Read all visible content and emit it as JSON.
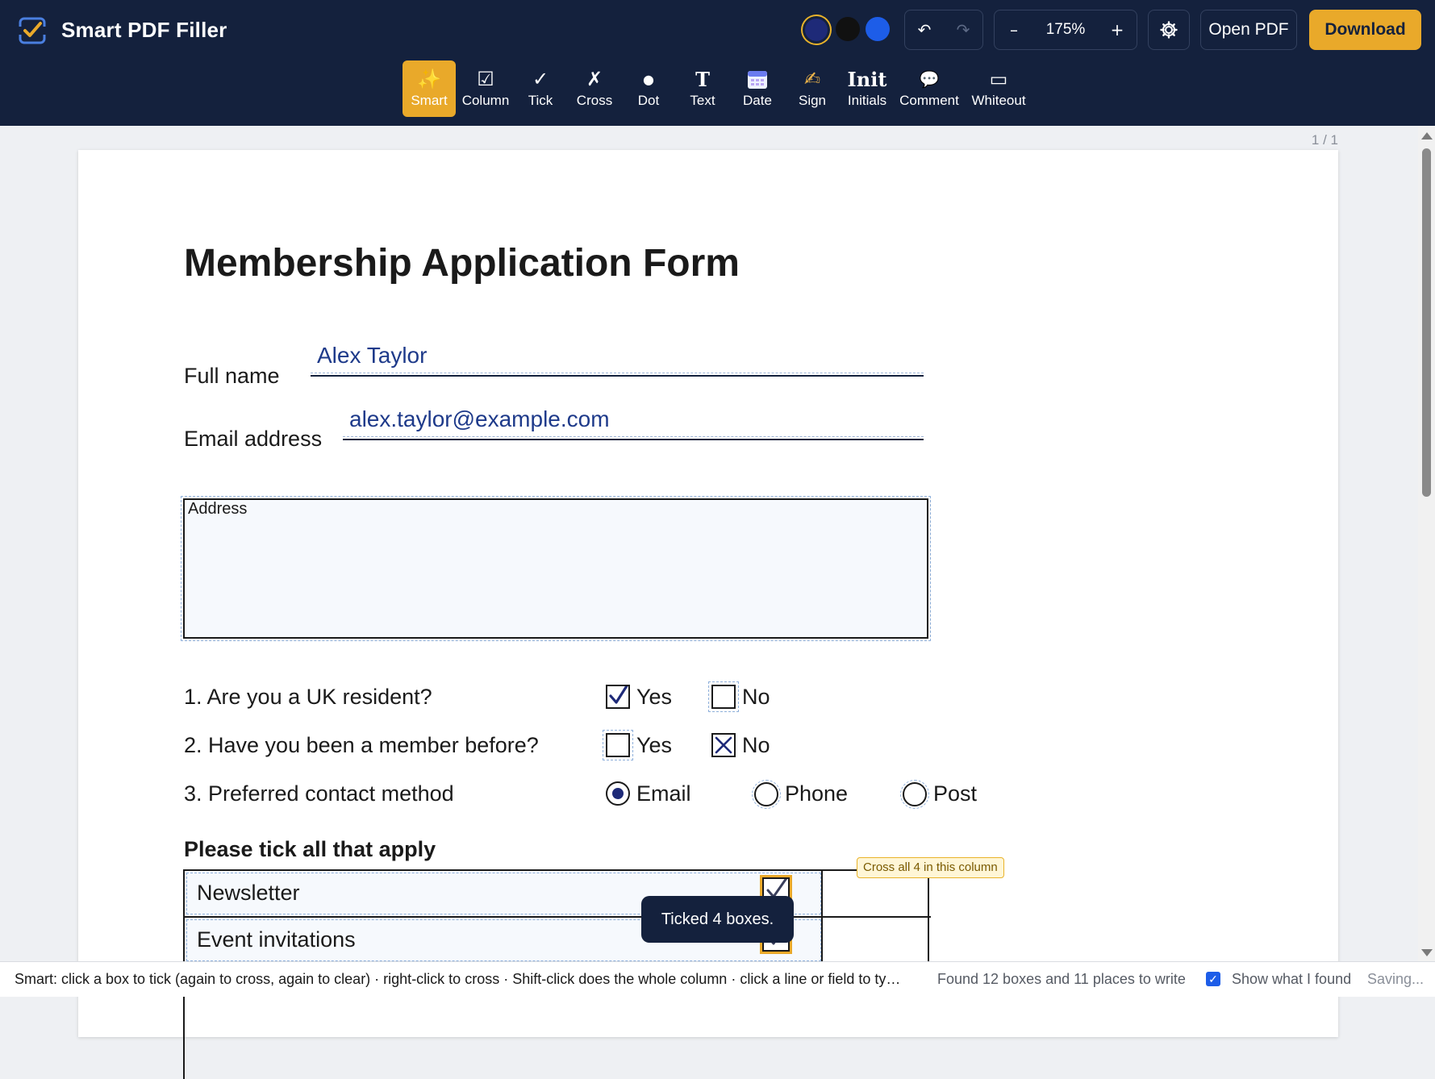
{
  "app": {
    "title": "Smart PDF Filler",
    "colors": {
      "navy": "#1e2a78",
      "black": "#111111",
      "blue": "#1d5de8",
      "accent": "#e9a92a",
      "bar": "#14213d"
    }
  },
  "toolbar": {
    "undo_icon": "↶",
    "redo_icon": "↷",
    "zoom_out": "–",
    "zoom_value": "175%",
    "zoom_in": "+",
    "settings_icon": "gear-icon",
    "open_label": "Open PDF",
    "download_label": "Download"
  },
  "tools": [
    {
      "label": "Smart",
      "icon": "sparkle-icon",
      "glyph": "✨",
      "active": true
    },
    {
      "label": "Column",
      "icon": "column-check-icon",
      "glyph": "☑"
    },
    {
      "label": "Tick",
      "icon": "tick-icon",
      "glyph": "✓"
    },
    {
      "label": "Cross",
      "icon": "cross-icon",
      "glyph": "✗"
    },
    {
      "label": "Dot",
      "icon": "dot-icon",
      "glyph": "●"
    },
    {
      "label": "Text",
      "icon": "text-icon",
      "glyph": "T"
    },
    {
      "label": "Date",
      "icon": "calendar-icon",
      "glyph": ""
    },
    {
      "label": "Sign",
      "icon": "sign-icon",
      "glyph": "✍"
    },
    {
      "label": "Initials",
      "icon": "initials-icon",
      "glyph": "Init"
    },
    {
      "label": "Comment",
      "icon": "comment-icon",
      "glyph": "💬"
    },
    {
      "label": "Whiteout",
      "icon": "whiteout-icon",
      "glyph": "▭"
    }
  ],
  "page_counter": "1 / 1",
  "form": {
    "title": "Membership Application Form",
    "full_name_label": "Full name",
    "full_name_value": "Alex Taylor",
    "email_label": "Email address",
    "email_value": "alex.taylor@example.com",
    "address_label": "Address",
    "questions": [
      {
        "text": "1. Are you a UK resident?",
        "yes": "Yes",
        "no": "No",
        "state": "yes-ticked"
      },
      {
        "text": "2. Have you been a member before?",
        "yes": "Yes",
        "no": "No",
        "state": "no-crossed"
      },
      {
        "text": "3. Preferred contact method",
        "options": [
          "Email",
          "Phone",
          "Post"
        ],
        "selected": "Email"
      }
    ],
    "apply_heading": "Please tick all that apply",
    "apply_rows": [
      {
        "label": "Newsletter",
        "checked": true
      },
      {
        "label": "Event invitations",
        "checked": true
      }
    ],
    "column_hint": "Cross all 4 in this column"
  },
  "toast": "Ticked 4 boxes.",
  "statusbar": {
    "hint": "Smart: click a box to tick (again to cross, again to clear) · right-click to cross · Shift-click does the whole column · click a line or field to typ...",
    "found": "Found 12 boxes and 11 places to write",
    "show_label": "Show what I found",
    "show_checked": true,
    "saving": "Saving..."
  }
}
